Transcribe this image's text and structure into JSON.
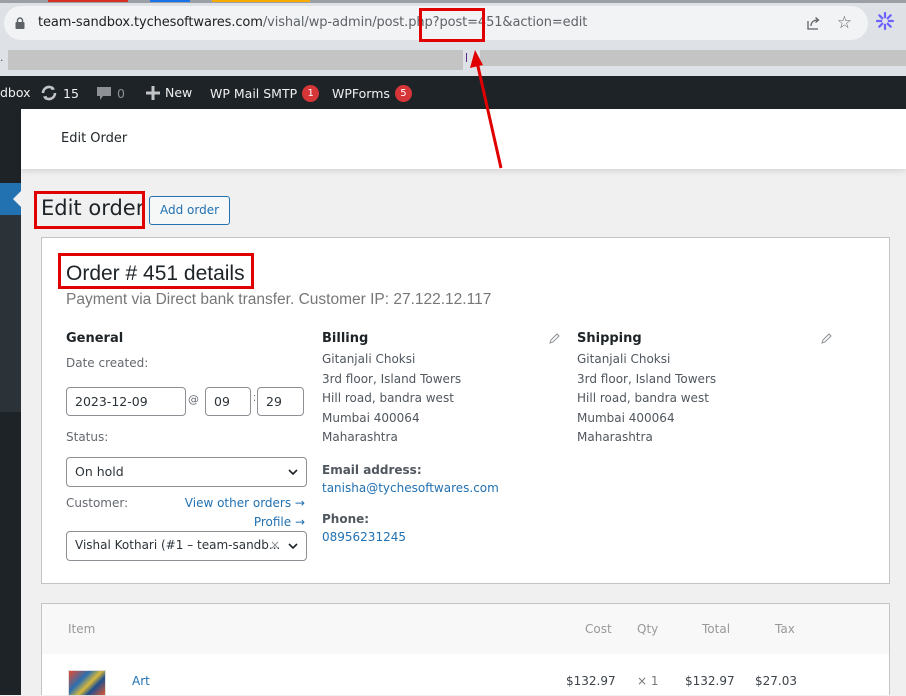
{
  "browser": {
    "url_host": "team-sandbox.tychesoftwares.com",
    "url_path": "/vishal/wp-admin/post.php?post=451&action=edit",
    "tab_colors": [
      "#d93025",
      "#1a73e8",
      "#f9ab00"
    ],
    "extension_color": "#6c63ff"
  },
  "adminbar": {
    "site_name": "dbox",
    "updates_count": "15",
    "comments_count": "0",
    "new_label": "New",
    "wp_mail_smtp_label": "WP Mail SMTP",
    "wp_mail_smtp_badge": "1",
    "wpforms_label": "WPForms",
    "wpforms_badge": "5"
  },
  "wc_header": {
    "title": "Edit Order"
  },
  "page": {
    "title": "Edit order",
    "add_order_label": "Add order"
  },
  "order": {
    "heading": "Order # 451 details",
    "meta": "Payment via Direct bank transfer. Customer IP: 27.122.12.117",
    "general": {
      "heading": "General",
      "date_created_label": "Date created:",
      "date": "2023-12-09",
      "at_symbol": "@",
      "hour": "09",
      "time_sep": ":",
      "minute": "29",
      "status_label": "Status:",
      "status_value": "On hold",
      "customer_label": "Customer:",
      "view_other_orders": "View other orders →",
      "profile_link": "Profile →",
      "customer_value": "Vishal Kothari (#1 – team-sandb...",
      "clear_glyph": "×"
    },
    "billing": {
      "heading": "Billing",
      "lines": [
        "Gitanjali Choksi",
        "3rd floor, Island Towers",
        "Hill road, bandra west",
        "Mumbai 400064",
        "Maharashtra"
      ],
      "email_label": "Email address:",
      "email": "tanisha@tychesoftwares.com",
      "phone_label": "Phone:",
      "phone": "08956231245"
    },
    "shipping": {
      "heading": "Shipping",
      "lines": [
        "Gitanjali Choksi",
        "3rd floor, Island Towers",
        "Hill road, bandra west",
        "Mumbai 400064",
        "Maharashtra"
      ]
    }
  },
  "items": {
    "headers": {
      "item": "Item",
      "cost": "Cost",
      "qty": "Qty",
      "total": "Total",
      "tax": "Tax"
    },
    "rows": [
      {
        "name": "Art",
        "cost": "$132.97",
        "qty": "× 1",
        "total": "$132.97",
        "tax": "$27.03"
      }
    ]
  },
  "annotation_color": "#e00000"
}
